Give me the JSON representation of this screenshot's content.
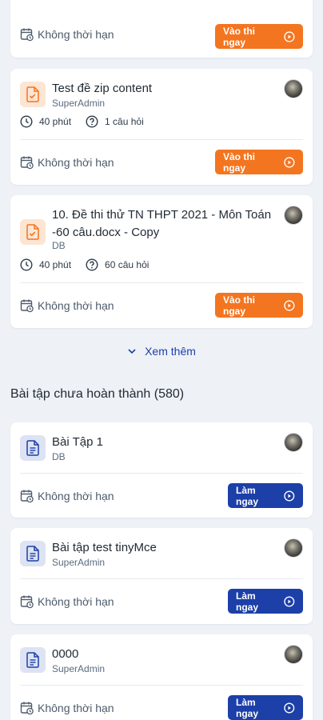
{
  "colors": {
    "orange": "#f47520",
    "blue": "#1c3fa8"
  },
  "top_card": {
    "deadline": "Không thời hạn",
    "button": "Vào thi ngay"
  },
  "exams": [
    {
      "title": "Test đề zip content",
      "author": "SuperAdmin",
      "duration": "40 phút",
      "questions": "1 câu hỏi",
      "deadline": "Không thời hạn",
      "button": "Vào thi ngay"
    },
    {
      "title": "10. Đề thi thử TN THPT 2021 - Môn Toán -60 câu.docx - Copy",
      "author": "DB",
      "duration": "40 phút",
      "questions": "60 câu hỏi",
      "deadline": "Không thời hạn",
      "button": "Vào thi ngay"
    }
  ],
  "see_more": "Xem thêm",
  "section_title": "Bài tập chưa hoàn thành (580)",
  "assignments": [
    {
      "title": "Bài Tập 1",
      "author": "DB",
      "deadline": "Không thời hạn",
      "button": "Làm ngay"
    },
    {
      "title": "Bài tập test tinyMce",
      "author": "SuperAdmin",
      "deadline": "Không thời hạn",
      "button": "Làm ngay"
    },
    {
      "title": "0000",
      "author": "SuperAdmin",
      "deadline": "Không thời hạn",
      "button": "Làm ngay"
    }
  ],
  "icons": {
    "calendar": "calendar-clock-icon",
    "clock": "clock-icon",
    "question": "question-circle-icon",
    "play": "play-circle-icon",
    "chevron": "chevron-down-icon",
    "exam_doc": "document-check-icon",
    "assignment_doc": "document-lines-icon"
  }
}
